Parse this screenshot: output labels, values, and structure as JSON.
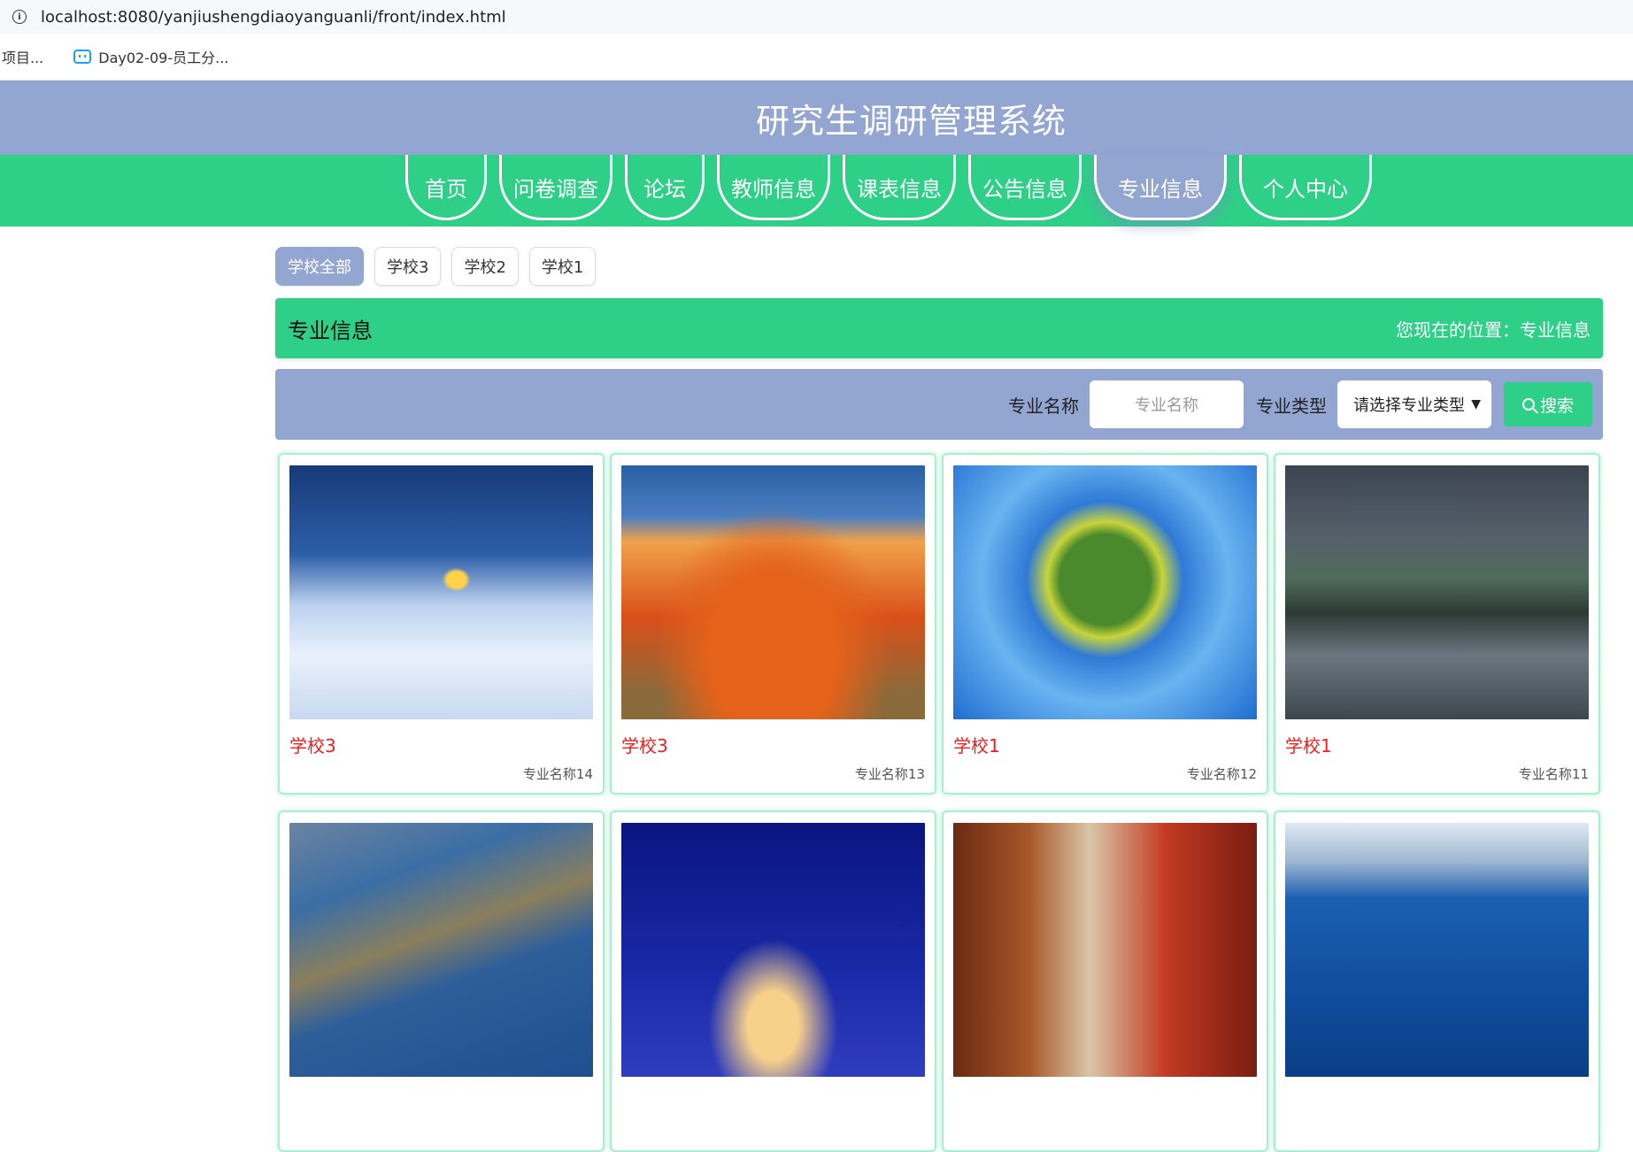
{
  "browser": {
    "url": "localhost:8080/yanjiushengdiaoyanguanli/front/index.html",
    "bookmarks": [
      "项目...",
      "Day02-09-员工分..."
    ]
  },
  "header": {
    "title": "研究生调研管理系统"
  },
  "nav": {
    "items": [
      "首页",
      "问卷调查",
      "论坛",
      "教师信息",
      "课表信息",
      "公告信息",
      "专业信息",
      "个人中心"
    ],
    "active": "专业信息"
  },
  "filters": [
    "学校全部",
    "学校3",
    "学校2",
    "学校1"
  ],
  "section": {
    "title": "专业信息",
    "breadcrumb": "您现在的位置：专业信息"
  },
  "search": {
    "name_label": "专业名称",
    "name_placeholder": "专业名称",
    "type_label": "专业类型",
    "type_value": "请选择专业类型",
    "button": "搜索"
  },
  "cards": [
    {
      "school": "学校3",
      "major": "专业名称14"
    },
    {
      "school": "学校3",
      "major": "专业名称13"
    },
    {
      "school": "学校1",
      "major": "专业名称12"
    },
    {
      "school": "学校1",
      "major": "专业名称11"
    },
    {
      "school": "",
      "major": ""
    },
    {
      "school": "",
      "major": ""
    },
    {
      "school": "",
      "major": ""
    },
    {
      "school": "",
      "major": ""
    }
  ],
  "colors": {
    "header": "#93a6d2",
    "nav": "#2ecf87",
    "school_text": "#f01e1e"
  }
}
